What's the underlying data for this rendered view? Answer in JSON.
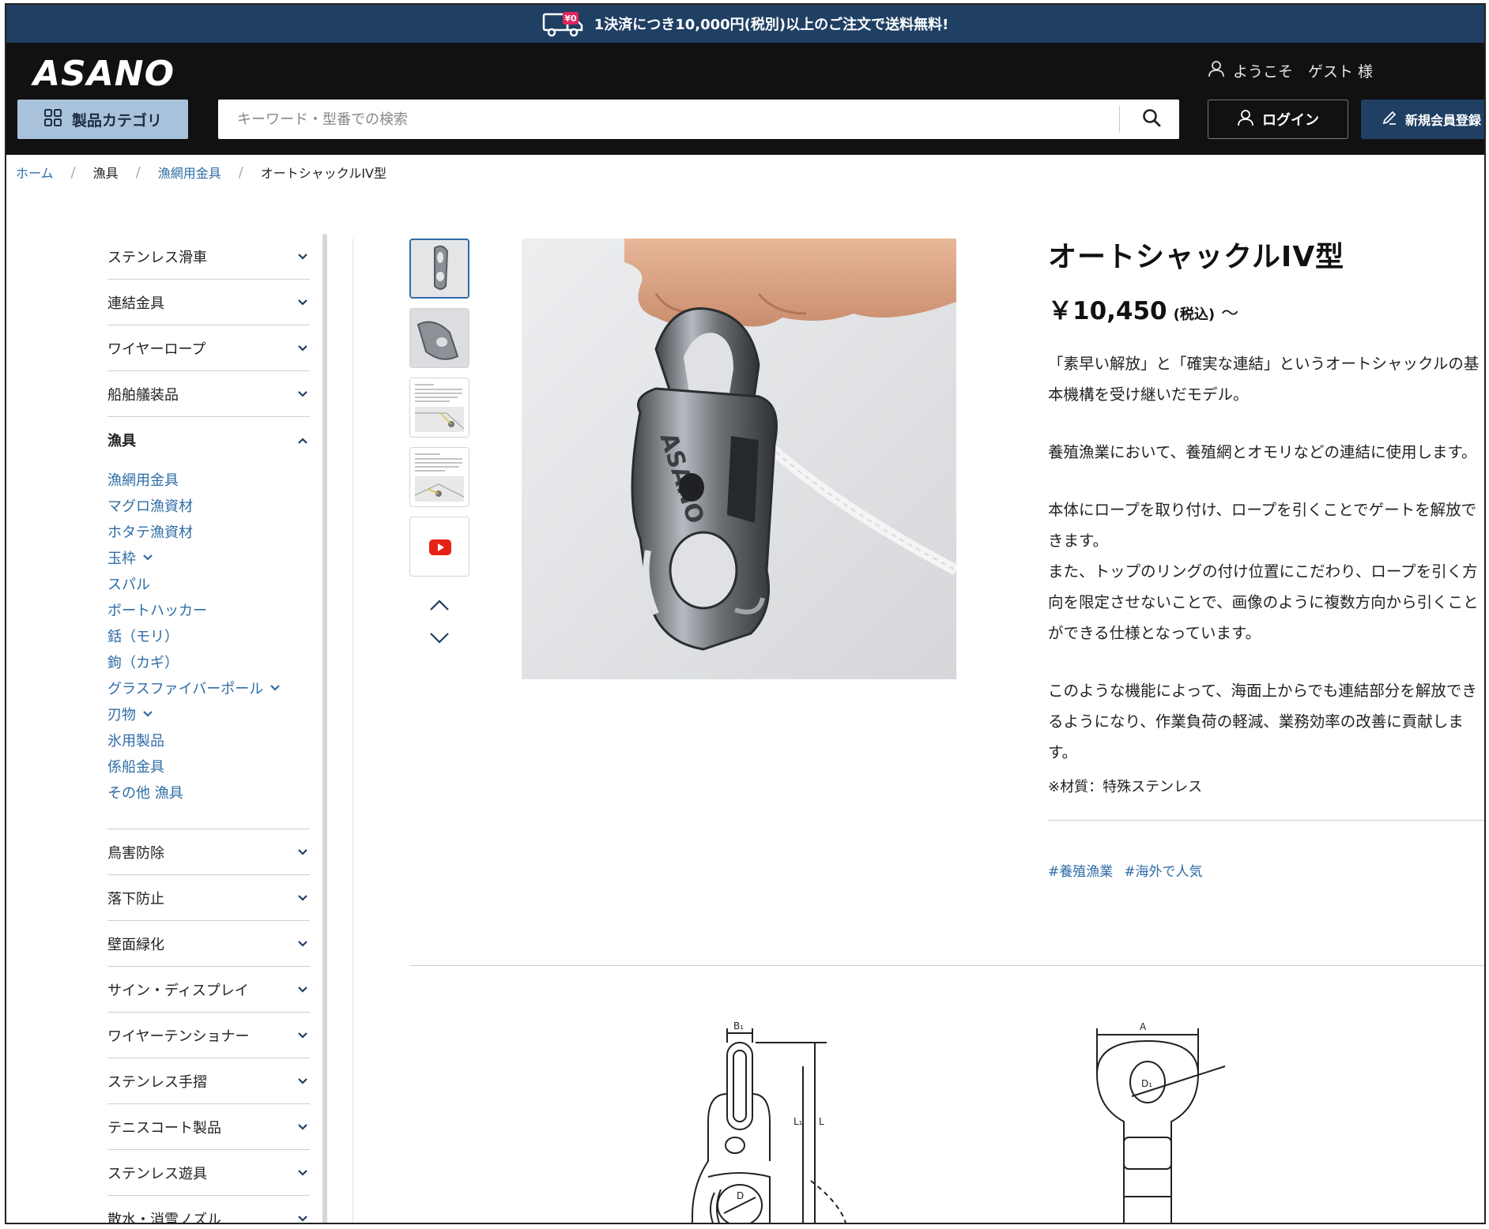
{
  "promo": {
    "icon": "truck-icon",
    "badge": "¥0",
    "text": "1決済につき10,000円(税別)以上のご注文で送料無料!"
  },
  "header": {
    "logo": "ASANO",
    "welcome": "ようこそ　ゲスト 様",
    "category_button": "製品カテゴリ",
    "search_placeholder": "キーワード・型番での検索",
    "login_button": "ログイン",
    "register_button": "新規会員登録"
  },
  "breadcrumb": [
    "ホーム",
    "漁具",
    "漁網用金具",
    "オートシャックルIV型"
  ],
  "sidebar": {
    "categories_top": [
      "ステンレス滑車",
      "連結金具",
      "ワイヤーロープ",
      "船舶艤装品"
    ],
    "open_category": "漁具",
    "subitems": [
      {
        "label": "漁網用金具",
        "has_children": false
      },
      {
        "label": "マグロ漁資材",
        "has_children": false
      },
      {
        "label": "ホタテ漁資材",
        "has_children": false
      },
      {
        "label": "玉枠",
        "has_children": true
      },
      {
        "label": "スパル",
        "has_children": false
      },
      {
        "label": "ボートハッカー",
        "has_children": false
      },
      {
        "label": "銛（モリ）",
        "has_children": false
      },
      {
        "label": "鉤（カギ）",
        "has_children": false
      },
      {
        "label": "グラスファイバーポール",
        "has_children": true
      },
      {
        "label": "刃物",
        "has_children": true
      },
      {
        "label": "氷用製品",
        "has_children": false
      },
      {
        "label": "係船金具",
        "has_children": false
      },
      {
        "label": "その他 漁具",
        "has_children": false
      }
    ],
    "categories_bottom": [
      "鳥害防除",
      "落下防止",
      "壁面緑化",
      "サイン・ディスプレイ",
      "ワイヤーテンショナー",
      "ステンレス手摺",
      "テニスコート製品",
      "ステンレス遊具",
      "散水・消雪ノズル"
    ]
  },
  "product": {
    "title": "オートシャックルIV型",
    "price": "￥10,450",
    "tax_label": "(税込)",
    "price_suffix": "～",
    "desc1": "「素早い解放」と「確実な連結」というオートシャックルの基本機構を受け継いだモデル。",
    "desc2": "養殖漁業において、養殖網とオモリなどの連結に使用します。",
    "desc3a": "本体にロープを取り付け、ロープを引くことでゲートを解放できます。",
    "desc3b": "また、トップのリングの付け位置にこだわり、ロープを引く方向を限定させないことで、画像のように複数方向から引くことができる仕様となっています。",
    "desc4": "このような機能によって、海面上からでも連結部分を解放できるようになり、作業負荷の軽減、業務効率の改善に貢献します。",
    "material": "※材質：特殊ステンレス",
    "tags": [
      "#養殖漁業",
      "#海外で人気"
    ],
    "image_text": "ASANO"
  },
  "drawing": {
    "labels_left": [
      "B₁",
      "L₁",
      "L",
      "D"
    ],
    "labels_right": [
      "A",
      "D₁"
    ]
  },
  "colors": {
    "navy": "#1f3f63",
    "header_bg": "#111111",
    "category_button": "#a9c2dc",
    "link": "#2e6ca6",
    "youtube_red": "#e62117"
  }
}
